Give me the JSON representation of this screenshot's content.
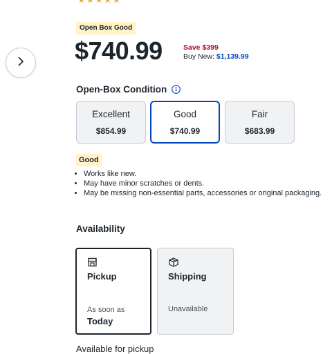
{
  "rating": {
    "stars": "★★★★★"
  },
  "badge": {
    "label": "Open Box Good"
  },
  "price": {
    "current": "$740.99",
    "save": "Save $399",
    "buy_new_label": "Buy New:",
    "buy_new_value": "$1,139.99"
  },
  "condition": {
    "heading": "Open-Box Condition",
    "options": [
      {
        "name": "Excellent",
        "price": "$854.99"
      },
      {
        "name": "Good",
        "price": "$740.99"
      },
      {
        "name": "Fair",
        "price": "$683.99"
      }
    ],
    "selected_label": "Good",
    "details": [
      "Works like new.",
      "May have minor scratches or dents.",
      "May be missing non-essential parts, accessories or original packaging."
    ]
  },
  "availability": {
    "heading": "Availability",
    "pickup": {
      "title": "Pickup",
      "sub": "As soon as",
      "when": "Today"
    },
    "shipping": {
      "title": "Shipping",
      "status": "Unavailable"
    },
    "footer": "Available for pickup"
  },
  "colors": {
    "accent_blue": "#0046be",
    "sale_red": "#bb0628",
    "badge_yellow": "#fff3c7"
  }
}
